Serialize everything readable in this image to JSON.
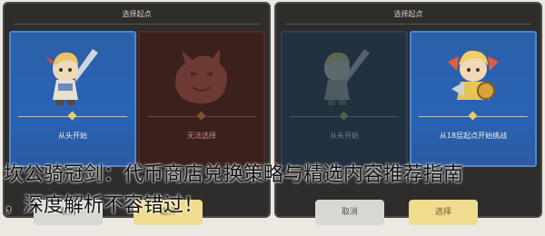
{
  "left_panel": {
    "title": "选择起点",
    "cards": [
      {
        "label": "从头开始",
        "state": "selected"
      },
      {
        "label": "无法选择",
        "state": "disabled"
      }
    ],
    "buttons": [
      {
        "label": "取消"
      },
      {
        "label": "选择"
      }
    ]
  },
  "right_panel": {
    "title": "选择起点",
    "cards": [
      {
        "label": "从头开始",
        "state": "dimmed"
      },
      {
        "label": "从18层起点开始挑战",
        "state": "selected"
      }
    ],
    "buttons": [
      {
        "label": "取消"
      },
      {
        "label": "选择"
      }
    ]
  },
  "article_title": {
    "line1": "坎公骑冠剑：代币商店兑换策略与精选内容推荐指南",
    "line2": "，深度解析不容错过！"
  },
  "colors": {
    "card_selected": "#2a63b5",
    "card_disabled": "#3b201d",
    "button_primary": "#f0dc8f",
    "button_secondary": "#d9d7d2"
  }
}
